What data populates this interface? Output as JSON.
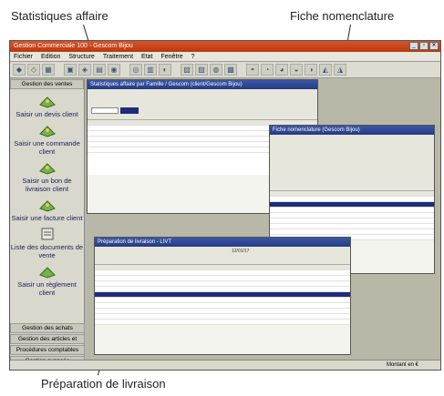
{
  "callouts": {
    "stats": "Statistiques affaire",
    "nomenclature": "Fiche nomenclature",
    "livraison": "Préparation de livraison"
  },
  "app": {
    "title": "Gestion Commerciale 100 - Gescom Bijou",
    "menu": [
      "Fichier",
      "Edition",
      "Structure",
      "Traitement",
      "Etat",
      "Fenêtre",
      "?"
    ],
    "win_buttons": [
      "_",
      "▫",
      "✕"
    ]
  },
  "sidebar": {
    "header": "Gestion des ventes",
    "items": [
      "Saisir un devis client",
      "Saisir une commande client",
      "Saisir un bon de livraison client",
      "Saisir une facture client",
      "Liste des documents de vente",
      "Saisir un règlement client"
    ],
    "footer": [
      "Gestion des achats",
      "Gestion des articles et",
      "Procédures comptables",
      "Gestion avancée"
    ]
  },
  "windows": {
    "stats_title": "Statistiques affaire par Famille / Gescom (client/Gescom Bijou)",
    "nomen_title": "Fiche nomenclature (Gescom Bijou)",
    "livraison_title": "Préparation de livraison - LIVT",
    "livraison_top_value": "12/01/17",
    "status_text": "Montant en €"
  },
  "icons": {
    "accent": "#243c80",
    "title_orange": "#c8461c"
  }
}
